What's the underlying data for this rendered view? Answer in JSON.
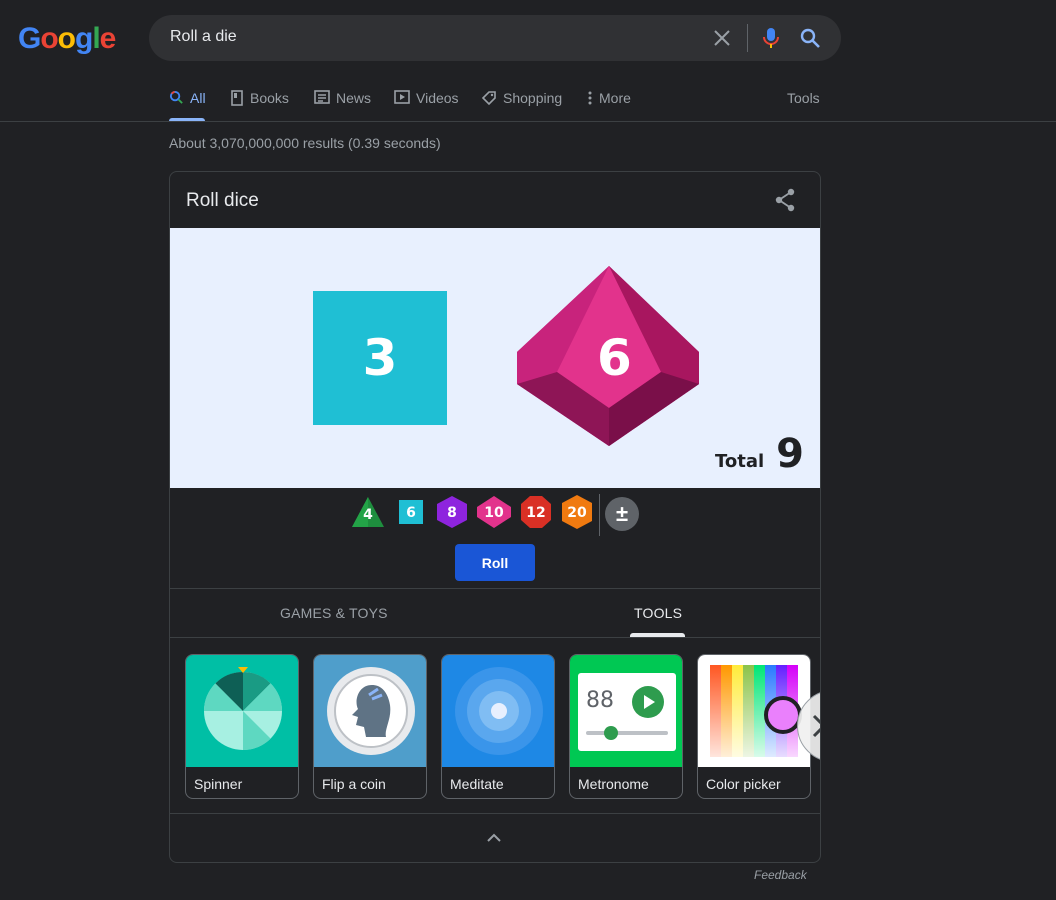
{
  "logo": {
    "text": "Google"
  },
  "search": {
    "query": "Roll a die"
  },
  "tabs": [
    {
      "label": "All"
    },
    {
      "label": "Books"
    },
    {
      "label": "News"
    },
    {
      "label": "Videos"
    },
    {
      "label": "Shopping"
    },
    {
      "label": "More"
    }
  ],
  "tools_label": "Tools",
  "result_stats": "About 3,070,000,000 results (0.39 seconds)",
  "card": {
    "title": "Roll dice",
    "dice_results": [
      {
        "die": "d6",
        "value": "3",
        "color": "#1fbfd4"
      },
      {
        "die": "d10",
        "value": "6",
        "color": "#e2338c"
      }
    ],
    "total_label": "Total",
    "total_value": "9",
    "dice_options": [
      {
        "label": "4",
        "color": "#1e8e3e"
      },
      {
        "label": "6",
        "color": "#1fbfd4"
      },
      {
        "label": "8",
        "color": "#8e24de"
      },
      {
        "label": "10",
        "color": "#e2338c"
      },
      {
        "label": "12",
        "color": "#d93025"
      },
      {
        "label": "20",
        "color": "#f07a10"
      }
    ],
    "modifier_label": "±",
    "roll_button": "Roll",
    "categories": [
      {
        "label": "GAMES & TOYS"
      },
      {
        "label": "TOOLS"
      }
    ],
    "tiles": [
      {
        "label": "Spinner"
      },
      {
        "label": "Flip a coin"
      },
      {
        "label": "Meditate"
      },
      {
        "label": "Metronome",
        "display": "88"
      },
      {
        "label": "Color picker"
      }
    ]
  },
  "feedback": "Feedback"
}
